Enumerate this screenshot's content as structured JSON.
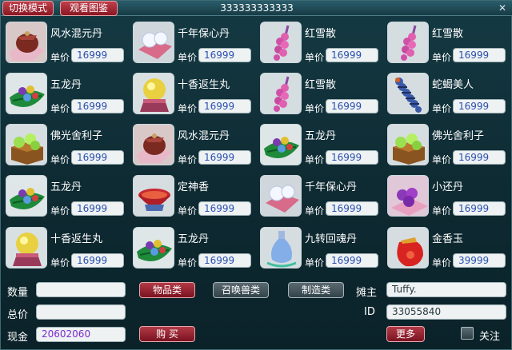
{
  "header": {
    "switch_mode_label": "切换模式",
    "view_catalog_label": "观看图鉴",
    "title": "333333333333"
  },
  "price_label": "单价",
  "items": [
    {
      "name": "风水混元丹",
      "price": "16999",
      "icon": "pouch-on-cloth-icon"
    },
    {
      "name": "千年保心丹",
      "price": "16999",
      "icon": "white-pills-icon"
    },
    {
      "name": "红雪散",
      "price": "16999",
      "icon": "pink-berries-icon"
    },
    {
      "name": "红雪散",
      "price": "16999",
      "icon": "pink-berries-icon"
    },
    {
      "name": "五龙丹",
      "price": "16999",
      "icon": "leaf-with-beads-icon"
    },
    {
      "name": "十香返生丸",
      "price": "16999",
      "icon": "golden-orb-icon"
    },
    {
      "name": "红雪散",
      "price": "16999",
      "icon": "pink-berries-icon"
    },
    {
      "name": "蛇蝎美人",
      "price": "16999",
      "icon": "centipede-icon"
    },
    {
      "name": "佛光舍利子",
      "price": "16999",
      "icon": "green-orbs-box-icon"
    },
    {
      "name": "风水混元丹",
      "price": "16999",
      "icon": "pouch-on-cloth-icon"
    },
    {
      "name": "五龙丹",
      "price": "16999",
      "icon": "leaf-with-beads-icon"
    },
    {
      "name": "佛光舍利子",
      "price": "16999",
      "icon": "green-orbs-box-icon"
    },
    {
      "name": "五龙丹",
      "price": "16999",
      "icon": "leaf-with-beads-icon"
    },
    {
      "name": "定神香",
      "price": "16999",
      "icon": "incense-bowl-icon"
    },
    {
      "name": "千年保心丹",
      "price": "16999",
      "icon": "white-pills-icon"
    },
    {
      "name": "小还丹",
      "price": "16999",
      "icon": "purple-pills-icon"
    },
    {
      "name": "十香返生丸",
      "price": "16999",
      "icon": "golden-orb-icon"
    },
    {
      "name": "五龙丹",
      "price": "16999",
      "icon": "leaf-with-beads-icon"
    },
    {
      "name": "九转回魂丹",
      "price": "16999",
      "icon": "blue-bottle-icon"
    },
    {
      "name": "金香玉",
      "price": "39999",
      "icon": "red-sack-icon"
    }
  ],
  "footer": {
    "quantity_label": "数量",
    "quantity_value": "",
    "total_label": "总价",
    "total_value": "",
    "cash_label": "现金",
    "cash_value": "20602060",
    "category_goods": "物品类",
    "category_summon": "召唤兽类",
    "category_craft": "制造类",
    "buy_label": "购 买",
    "seller_label": "摊主",
    "seller_value": "Tuffy.",
    "id_label": "ID",
    "id_value": "33055840",
    "more_label": "更多",
    "follow_label": "关注"
  },
  "colors": {
    "background": "#0f2b33",
    "accent_red": "#8a1622",
    "price_text": "#2a4fb0",
    "cash_text": "#7a2bd0"
  }
}
